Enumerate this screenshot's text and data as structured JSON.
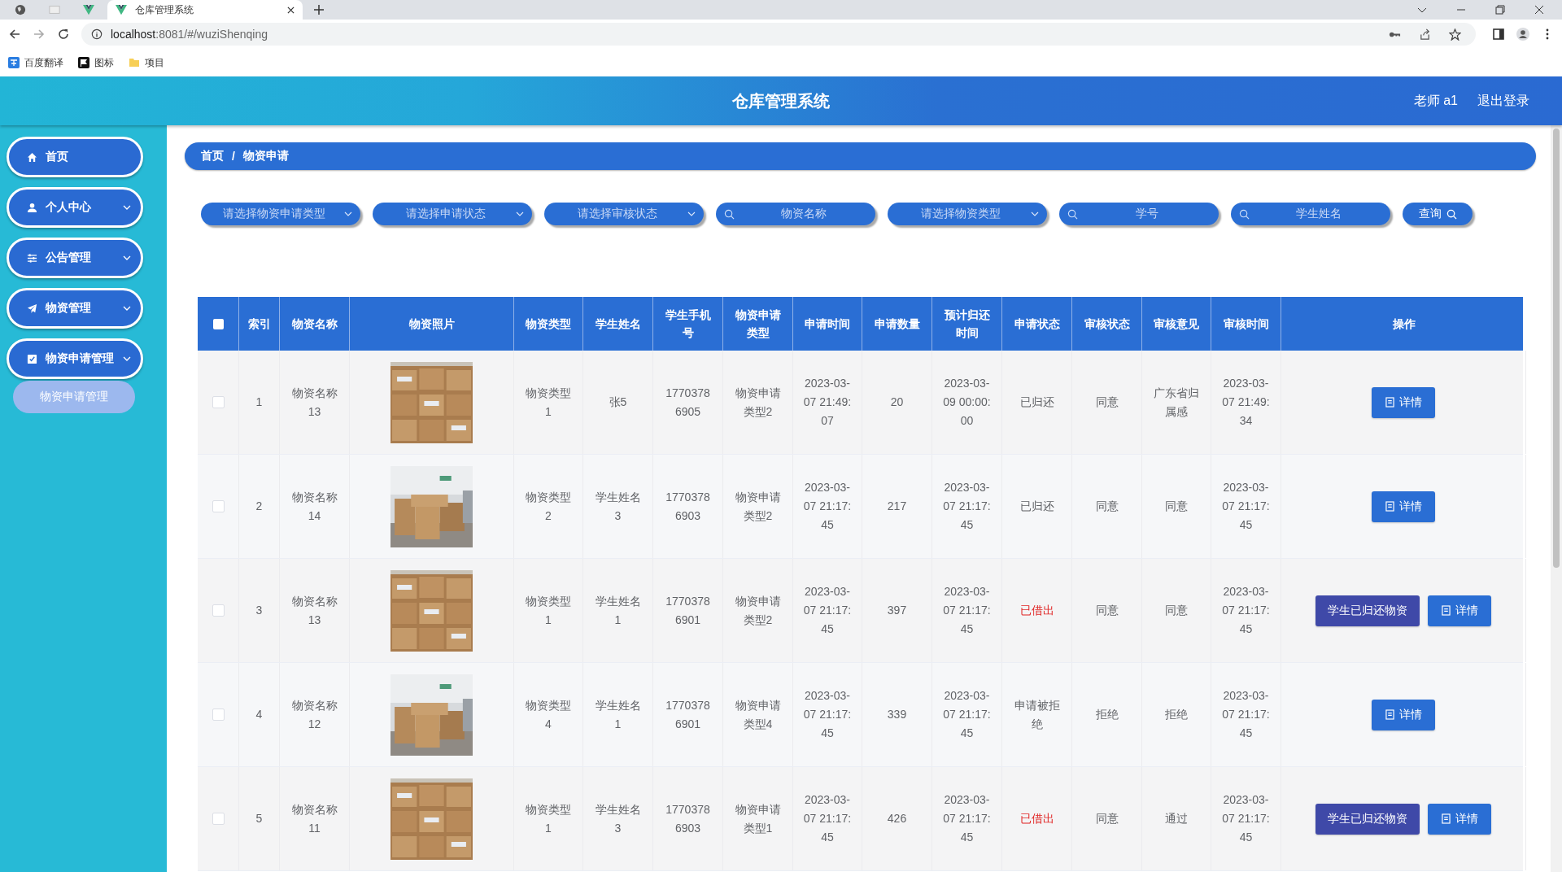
{
  "browser": {
    "tabs": [
      {
        "kind": "globe",
        "selected": false
      },
      {
        "kind": "blank",
        "selected": false
      },
      {
        "kind": "vue",
        "selected": false
      },
      {
        "title": "仓库管理系统",
        "kind": "vue",
        "selected": true
      }
    ],
    "address": {
      "host": "localhost",
      "rest": ":8081/#/wuziShenqing"
    },
    "bookmarks": [
      {
        "label": "百度翻译",
        "kind": "translate"
      },
      {
        "label": "图标",
        "kind": "flag"
      },
      {
        "label": "项目",
        "kind": "folder"
      }
    ]
  },
  "header": {
    "title": "仓库管理系统",
    "user": "老师 a1",
    "logout": "退出登录"
  },
  "sidebar": {
    "items": [
      {
        "label": "首页",
        "has_submenu": false
      },
      {
        "label": "个人中心",
        "has_submenu": true
      },
      {
        "label": "公告管理",
        "has_submenu": true
      },
      {
        "label": "物资管理",
        "has_submenu": true
      },
      {
        "label": "物资申请管理",
        "has_submenu": true,
        "children": [
          {
            "label": "物资申请管理"
          }
        ]
      }
    ]
  },
  "breadcrumb": {
    "items": [
      "首页",
      "物资申请"
    ],
    "separator": "/"
  },
  "filters": [
    {
      "kind": "select",
      "placeholder": "请选择物资申请类型"
    },
    {
      "kind": "select",
      "placeholder": "请选择申请状态"
    },
    {
      "kind": "select",
      "placeholder": "请选择审核状态"
    },
    {
      "kind": "search",
      "placeholder": "物资名称"
    },
    {
      "kind": "select",
      "placeholder": "请选择物资类型"
    },
    {
      "kind": "search",
      "placeholder": "学号"
    },
    {
      "kind": "search",
      "placeholder": "学生姓名"
    }
  ],
  "query_button": "查询",
  "table": {
    "all_checked": false,
    "columns": [
      "索引",
      "物资名称",
      "物资照片",
      "物资类型",
      "学生姓名",
      "学生手机号",
      "物资申请类型",
      "申请时间",
      "申请数量",
      "预计归还时间",
      "申请状态",
      "审核状态",
      "审核意见",
      "审核时间",
      "操作"
    ],
    "rows": [
      {
        "checked": false,
        "index": "1",
        "name": "物资名称13",
        "photo": {
          "kind": "picture"
        },
        "type": "物资类型1",
        "student": "张5",
        "phone": "17703786905",
        "apply_type": "物资申请类型2",
        "apply_time": "2023-03-07 21:49:07",
        "quantity": "20",
        "return_time": "2023-03-09 00:00:00",
        "status": {
          "text": "已归还",
          "color": "#606266"
        },
        "review_status": "同意",
        "review_opinion": "广东省归属感",
        "review_time": "2023-03-07 21:49:34",
        "actions": [
          {
            "kind": "detail",
            "label": "详情"
          }
        ]
      },
      {
        "checked": false,
        "index": "2",
        "name": "物资名称14",
        "photo": {
          "kind": "picture"
        },
        "type": "物资类型2",
        "student": "学生姓名3",
        "phone": "17703786903",
        "apply_type": "物资申请类型2",
        "apply_time": "2023-03-07 21:17:45",
        "quantity": "217",
        "return_time": "2023-03-07 21:17:45",
        "status": {
          "text": "已归还",
          "color": "#606266"
        },
        "review_status": "同意",
        "review_opinion": "同意",
        "review_time": "2023-03-07 21:17:45",
        "actions": [
          {
            "kind": "detail",
            "label": "详情"
          }
        ]
      },
      {
        "checked": false,
        "index": "3",
        "name": "物资名称13",
        "photo": {
          "kind": "picture"
        },
        "type": "物资类型1",
        "student": "学生姓名1",
        "phone": "17703786901",
        "apply_type": "物资申请类型2",
        "apply_time": "2023-03-07 21:17:45",
        "quantity": "397",
        "return_time": "2023-03-07 21:17:45",
        "status": {
          "text": "已借出",
          "color": "#e02424"
        },
        "review_status": "同意",
        "review_opinion": "同意",
        "review_time": "2023-03-07 21:17:45",
        "actions": [
          {
            "kind": "return",
            "label": "学生已归还物资"
          },
          {
            "kind": "detail",
            "label": "详情"
          }
        ]
      },
      {
        "checked": false,
        "index": "4",
        "name": "物资名称12",
        "photo": {
          "kind": "picture"
        },
        "type": "物资类型4",
        "student": "学生姓名1",
        "phone": "17703786901",
        "apply_type": "物资申请类型4",
        "apply_time": "2023-03-07 21:17:45",
        "quantity": "339",
        "return_time": "2023-03-07 21:17:45",
        "status": {
          "text": "申请被拒绝",
          "color": "#606266"
        },
        "review_status": "拒绝",
        "review_opinion": "拒绝",
        "review_time": "2023-03-07 21:17:45",
        "actions": [
          {
            "kind": "detail",
            "label": "详情"
          }
        ]
      },
      {
        "checked": false,
        "index": "5",
        "name": "物资名称11",
        "photo": {
          "kind": "picture"
        },
        "type": "物资类型1",
        "student": "学生姓名3",
        "phone": "17703786903",
        "apply_type": "物资申请类型1",
        "apply_time": "2023-03-07 21:17:45",
        "quantity": "426",
        "return_time": "2023-03-07 21:17:45",
        "status": {
          "text": "已借出",
          "color": "#e02424"
        },
        "review_status": "同意",
        "review_opinion": "通过",
        "review_time": "2023-03-07 21:17:45",
        "actions": [
          {
            "kind": "return",
            "label": "学生已归还物资"
          },
          {
            "kind": "detail",
            "label": "详情"
          }
        ]
      }
    ]
  }
}
